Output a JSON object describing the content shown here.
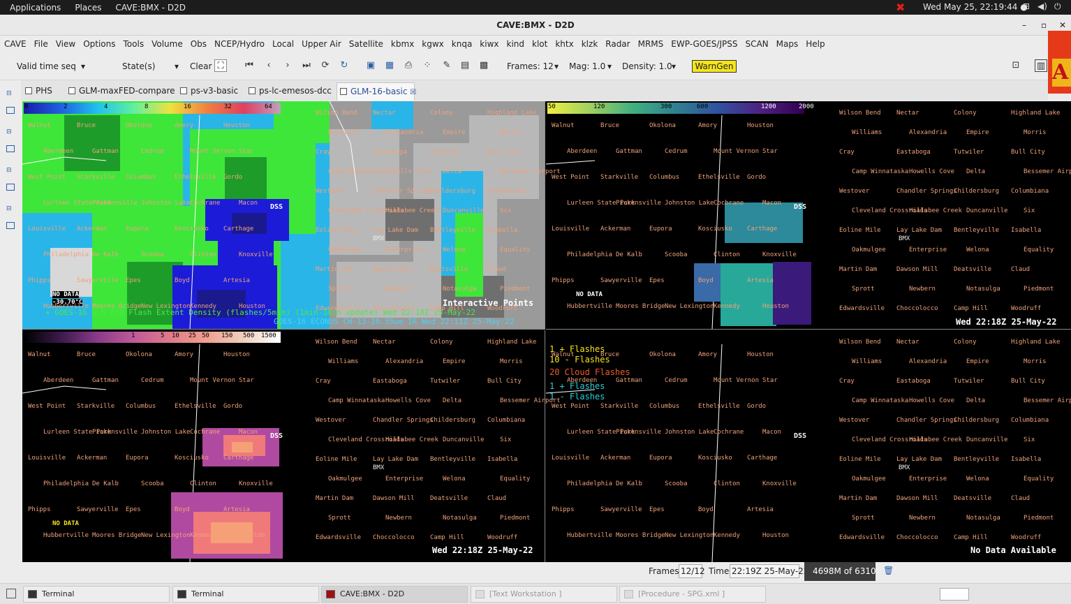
{
  "topbar": {
    "applications": "Applications",
    "places": "Places",
    "window": "CAVE:BMX - D2D",
    "clock": "Wed May 25, 22:19:44 ●"
  },
  "window_title": "CAVE:BMX - D2D",
  "menu": [
    "CAVE",
    "File",
    "View",
    "Options",
    "Tools",
    "Volume",
    "Obs",
    "NCEP/Hydro",
    "Local",
    "Upper Air",
    "Satellite",
    "kbmx",
    "kgwx",
    "knqa",
    "kiwx",
    "kind",
    "klot",
    "khtx",
    "klzk",
    "Radar",
    "MRMS",
    "EWP-GOES/JPSS",
    "SCAN",
    "Maps",
    "Help"
  ],
  "toolbar": {
    "valid_time": "Valid time seq",
    "states": "State(s)",
    "clear": "Clear",
    "frames": "Frames: 12",
    "mag": "Mag: 1.0",
    "density": "Density: 1.0",
    "warngen": "WarnGen"
  },
  "tabs": [
    "PHS",
    "GLM-maxFED-compare",
    "ps-v3-basic",
    "ps-lc-emesos-dcc",
    "GLM-16-basic"
  ],
  "panels": {
    "top_left": {
      "legend": [
        "0",
        "2",
        "4",
        "8",
        "16",
        "32",
        "64"
      ],
      "no_data": "NO DATA",
      "temp": "-30.70°C",
      "interactive": "Interactive Points",
      "caption1": "+ GOES-16 GLM FED Flash Extent Density (flashes/5min) (1min-1min update) Wed 22:18Z 25-May-22",
      "caption2": "GOES-16 ECONUS CH-13-10.35um IR Wed 22:11Z 25-May-22"
    },
    "top_right": {
      "legend": [
        "50",
        "120",
        "300",
        "600",
        "1200",
        "2000"
      ],
      "no_data": "NO DATA",
      "stamp": "Wed 22:18Z 25-May-22"
    },
    "bottom_left": {
      "legend": [
        "1",
        "5",
        "10",
        "25",
        "50",
        "150",
        "500",
        "1500"
      ],
      "no_data": "NO DATA",
      "stamp": "Wed 22:18Z 25-May-22"
    },
    "bottom_right": {
      "labels": [
        "1 + Flashes",
        "10 - Flashes",
        "20 Cloud Flashes",
        "1 + Flashes",
        "1 - Flashes"
      ],
      "stamp": "No Data Available"
    },
    "dss": "DSS",
    "bmx": "BMX"
  },
  "places_left": [
    "Walnut",
    "Bruce",
    "Okolona",
    "Amory",
    "Houston",
    "Aberdeen",
    "Gattman",
    "Cedrum",
    "Mount Vernon",
    "Star",
    "West Point",
    "Starkville",
    "Columbus",
    "Ethelsville",
    "Gordo",
    "Lurleen State Park",
    "Pickensville",
    "Johnston Lake",
    "Cochrane",
    "Macon",
    "Louisville",
    "Ackerman",
    "Eupora",
    "Kosciusko",
    "Carthage",
    "Philadelphia",
    "De Kalb",
    "Scooba",
    "Clinton",
    "Knoxville",
    "Phipps",
    "Sawyerville",
    "Epes",
    "Boyd",
    "Artesia",
    "Hubbertville",
    "Moores Bridge",
    "New Lexington",
    "Kennedy",
    "Houston",
    "Bruce"
  ],
  "places_right": [
    "Wilson Bend",
    "Nectar",
    "Colony",
    "Highland Lake",
    "Williams",
    "Alexandria",
    "Empire",
    "Morris",
    "Cray",
    "Eastaboga",
    "Tutwiler",
    "Bull City",
    "Camp Winnataska",
    "Howells Cove",
    "Delta",
    "Bessemer Airport",
    "Westover",
    "Chandler Springs",
    "Childersburg",
    "Columbiana",
    "Cleveland Crossroads",
    "Hillabee Creek",
    "Duncanville",
    "Six",
    "Eoline Mile",
    "Lay Lake Dam",
    "Bentleyville",
    "Isabella",
    "Oakmulgee",
    "Enterprise",
    "Welona",
    "Equality",
    "Martin Dam",
    "Dawson Mill",
    "Deatsville",
    "Claud",
    "Sprott",
    "Newbern",
    "Notasulga",
    "Piedmont",
    "Edwardsville",
    "Choccolocco",
    "Camp Hill",
    "Woodruff",
    "Meridian"
  ],
  "status": {
    "frames_label": "Frames:",
    "frames": "12/12",
    "time_label": "Time:",
    "time": "22:19Z 25-May-22",
    "memory": "4698M of 6310M"
  },
  "taskbar": [
    "Terminal",
    "Terminal",
    "CAVE:BMX - D2D",
    "[Text Workstation ]",
    "[Procedure - SPG.xml ]"
  ]
}
